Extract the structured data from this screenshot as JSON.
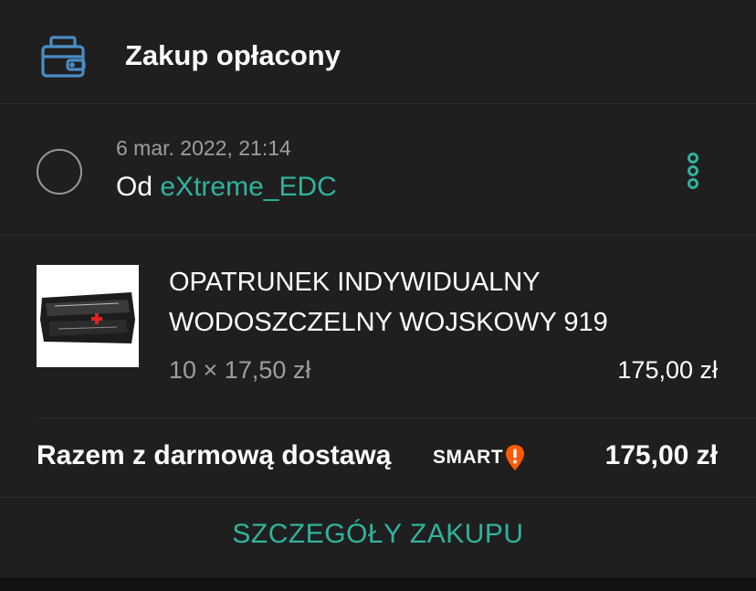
{
  "header": {
    "title": "Zakup opłacony",
    "icon": "wallet-icon",
    "icon_color": "#4a8cc4"
  },
  "order": {
    "date": "6 mar. 2022, 21:14",
    "seller_prefix": "Od",
    "seller_name": "eXtreme_EDC",
    "selected": false
  },
  "item": {
    "name_line1": "OPATRUNEK INDYWIDUALNY",
    "name_line2": "WODOSZCZELNY WOJSKOWY 919",
    "quantity_price": "10 × 17,50 zł",
    "line_total": "175,00 zł",
    "thumbnail": "product-photo"
  },
  "summary": {
    "total_label": "Razem z darmową dostawą",
    "smart_badge": "SMART",
    "total": "175,00 zł"
  },
  "actions": {
    "details_label": "SZCZEGÓŁY ZAKUPU"
  },
  "colors": {
    "accent": "#2fb39c",
    "background": "#1f1f1f",
    "smart_orange": "#ff5a00"
  }
}
